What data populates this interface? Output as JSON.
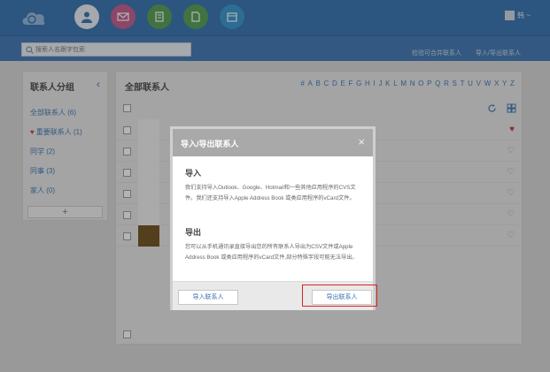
{
  "nav": {
    "user_label": "韩 ~",
    "icons": [
      {
        "name": "contacts-icon",
        "color": "#cfd9e6"
      },
      {
        "name": "mail-icon",
        "color": "#b9457e"
      },
      {
        "name": "notes-icon",
        "color": "#3b8a3e"
      },
      {
        "name": "files-icon",
        "color": "#3a8a3e"
      },
      {
        "name": "calendar-icon",
        "color": "#2b8ac4"
      }
    ]
  },
  "subbar": {
    "search_placeholder": "搜索人名跟字包索",
    "link_find": "检验可合并联系人",
    "link_import_export": "导入/导出联系人"
  },
  "sidebar": {
    "title": "联系人分组",
    "items": [
      {
        "label": "全部联系人 (6)"
      },
      {
        "label": "重要联系人 (1)"
      },
      {
        "label": "同学 (2)"
      },
      {
        "label": "同事 (3)"
      },
      {
        "label": "家人 (0)"
      }
    ],
    "add_label": "+"
  },
  "main": {
    "title": "全部联系人",
    "alphabet": [
      "#",
      "A",
      "B",
      "C",
      "D",
      "E",
      "F",
      "G",
      "H",
      "I",
      "J",
      "K",
      "L",
      "M",
      "N",
      "O",
      "P",
      "Q",
      "R",
      "S",
      "T",
      "U",
      "V",
      "W",
      "X",
      "Y",
      "Z"
    ]
  },
  "modal": {
    "title": "导入/导出联系人",
    "close": "×",
    "import_heading": "导入",
    "import_text": "我们支持导入Outlook、Google、Hotmail和一些其他应用程序的CVS文件。我们还支持导入Apple Address Book 或类应用程序的vCard文件。",
    "export_heading": "导出",
    "export_text": "您可以从手机通讯录直接导出您的所有联系人导出为CSV文件或Apple Address Book 或类应用程序的vCard文件,部分特殊字段可能无法导出。",
    "import_button": "导入联系人",
    "export_button": "导出联系人"
  },
  "colors": {
    "brand_blue": "#2f6db0",
    "heart_red": "#c33",
    "highlight": "#d22"
  }
}
